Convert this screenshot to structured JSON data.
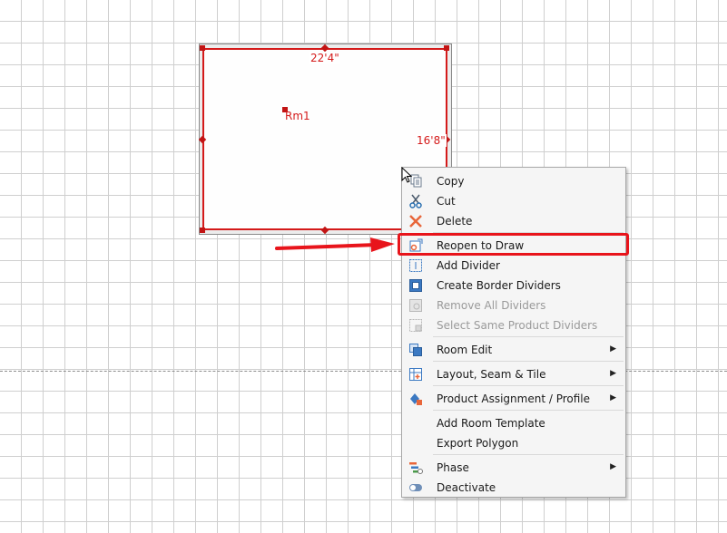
{
  "canvas": {
    "room": {
      "name": "Rm1",
      "width_label": "22'4\"",
      "height_label": "16'8\""
    }
  },
  "context_menu": {
    "items": [
      {
        "label": "Copy",
        "icon": "copy-icon",
        "enabled": true
      },
      {
        "label": "Cut",
        "icon": "cut-icon",
        "enabled": true
      },
      {
        "label": "Delete",
        "icon": "delete-icon",
        "enabled": true
      },
      {
        "label": "Reopen to Draw",
        "icon": "reopen-draw-icon",
        "enabled": true,
        "highlighted": true
      },
      {
        "label": "Add Divider",
        "icon": "add-divider-icon",
        "enabled": true
      },
      {
        "label": "Create Border Dividers",
        "icon": "border-dividers-icon",
        "enabled": true
      },
      {
        "label": "Remove All Dividers",
        "icon": "remove-dividers-icon",
        "enabled": false
      },
      {
        "label": "Select Same Product Dividers",
        "icon": "select-dividers-icon",
        "enabled": false
      },
      {
        "label": "Room Edit",
        "icon": "room-edit-icon",
        "enabled": true,
        "submenu": true
      },
      {
        "label": "Layout, Seam & Tile",
        "icon": "layout-icon",
        "enabled": true,
        "submenu": true
      },
      {
        "label": "Product Assignment / Profile",
        "icon": "product-icon",
        "enabled": true,
        "submenu": true
      },
      {
        "label": "Add Room Template",
        "icon": "",
        "enabled": true
      },
      {
        "label": "Export Polygon",
        "icon": "",
        "enabled": true
      },
      {
        "label": "Phase",
        "icon": "phase-icon",
        "enabled": true,
        "submenu": true
      },
      {
        "label": "Deactivate",
        "icon": "deactivate-icon",
        "enabled": true
      }
    ],
    "submenu_glyph": "▶"
  },
  "colors": {
    "room_outline": "#d41a1a",
    "highlight": "#e8141b",
    "arrow": "#e8141b"
  }
}
